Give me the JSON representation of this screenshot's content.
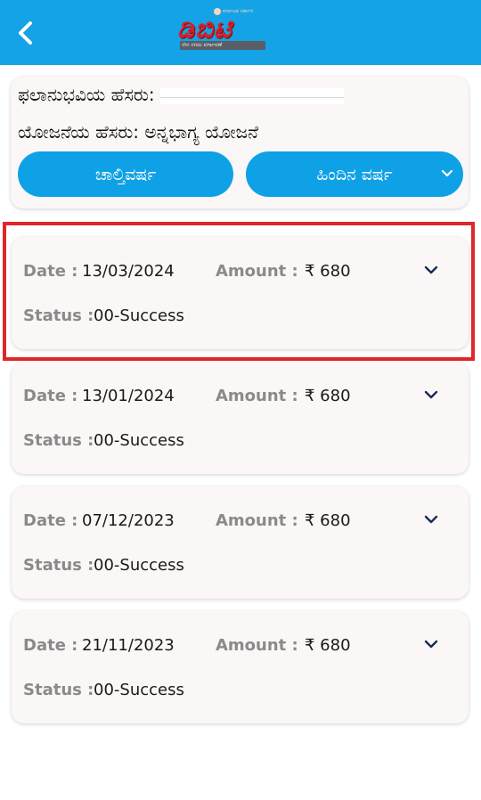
{
  "header": {
    "logo_text": "ಡಿಬಿಟಿ",
    "logo_tagline": "ಕರ್ನಾಟಕ ಸರ್ಕಾರ",
    "logo_subtitle": "ನೇರ ನಗದು ವರ್ಗಾವಣೆ",
    "brand_color": "#14a3e6"
  },
  "beneficiary": {
    "name_label": "ಫಲಾನುಭವಿಯ ಹೆಸರು:",
    "scheme_label": "ಯೋಜನೆಯ ಹೆಸರು:",
    "scheme_value": "ಅನ್ನಭಾಗ್ಯ ಯೋಜನೆ"
  },
  "year_tabs": {
    "current": "ಚಾಲ್ತಿವರ್ಷ",
    "previous": "ಹಿಂದಿನ ವರ್ಷ"
  },
  "labels": {
    "date": "Date :",
    "amount": "Amount :",
    "status": "Status :"
  },
  "payments": [
    {
      "date": "13/03/2024",
      "amount": "₹ 680",
      "status": "00-Success"
    },
    {
      "date": "13/01/2024",
      "amount": "₹ 680",
      "status": "00-Success"
    },
    {
      "date": "07/12/2023",
      "amount": "₹ 680",
      "status": "00-Success"
    },
    {
      "date": "21/11/2023",
      "amount": "₹ 680",
      "status": "00-Success"
    }
  ],
  "colors": {
    "highlight_border": "#e0262b",
    "button_blue": "#0fa1e6",
    "chevron_navy": "#1c2a5a"
  }
}
